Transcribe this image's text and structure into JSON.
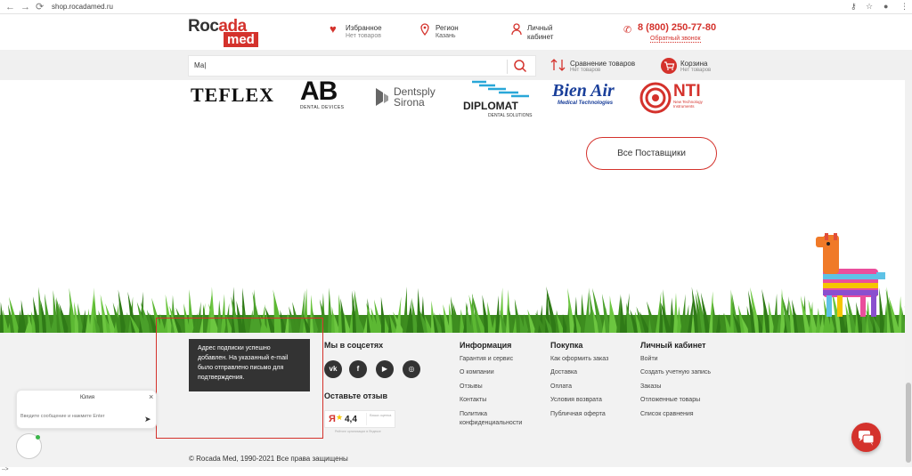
{
  "browser": {
    "url": "shop.rocadamed.ru",
    "back": "←",
    "forward": "→",
    "reload": "⟳"
  },
  "header": {
    "logo_line1_dark": "Roc",
    "logo_line1_accent": "ada",
    "logo_line2": "med",
    "favorites_title": "Избранное",
    "favorites_sub": "Нет товаров",
    "region_title": "Регион",
    "region_sub": "Казань",
    "account_title": "Личный",
    "account_sub": "кабинет",
    "phone": "8 (800) 250-77-80",
    "callback": "Обратный звонок",
    "compare_title": "Сравнение товаров",
    "compare_sub": "Нет товаров",
    "cart_title": "Корзина",
    "cart_sub": "Нет товаров"
  },
  "search": {
    "value": "Ма|",
    "placeholder": ""
  },
  "brands": {
    "teflex": "TEFLEX",
    "ab_big": "AB",
    "ab_small": "DENTAL DEVICES",
    "dentsply_1": "Dentsply",
    "dentsply_2": "Sirona",
    "diplomat": "DIPLOMAT",
    "diplomat_sub": "DENTAL SOLUTIONS",
    "bienair": "Bien Air",
    "bienair_sub": "Medical Technologies",
    "nti": "NTI",
    "nti_sub": "New Technology Instruments"
  },
  "all_suppliers_label": "Все Поставщики",
  "footer": {
    "social_title": "Мы в соцсетях",
    "social": [
      "vk",
      "f",
      "▶",
      "◎"
    ],
    "review_title": "Оставьте отзыв",
    "rating_logo": "Я",
    "rating_value": "4,4",
    "rating_badge": "Ваша оценка",
    "rating_caption": "Рейтинг организации в Яндексе",
    "info_title": "Информация",
    "info_links": [
      "Гарантия и сервис",
      "О компании",
      "Отзывы",
      "Контакты",
      "Политика",
      "конфиденциальности"
    ],
    "purchase_title": "Покупка",
    "purchase_links": [
      "Как оформить заказ",
      "Доставка",
      "Оплата",
      "Условия возврата",
      "Публичная оферта"
    ],
    "account_title": "Личный кабинет",
    "account_links": [
      "Войти",
      "Создать учетную запись",
      "Заказы",
      "Отложенные товары",
      "Список сравнения"
    ],
    "copyright": "© Rocada Med, 1990-2021 Все права защищены"
  },
  "toast": {
    "line1": "Адрес подписки успешно",
    "line2": "добавлен. На указанный e-mail",
    "line3": "было отправлено письмо для",
    "line4": "подтверждения."
  },
  "chat": {
    "agent_name": "Юлия",
    "close": "×",
    "placeholder": "Введите сообщение и нажмите Enter"
  },
  "statusbar_text": "-->",
  "colors": {
    "accent": "#d4322c",
    "footer_bg": "#f2f2f2",
    "toast_bg": "#333333"
  }
}
